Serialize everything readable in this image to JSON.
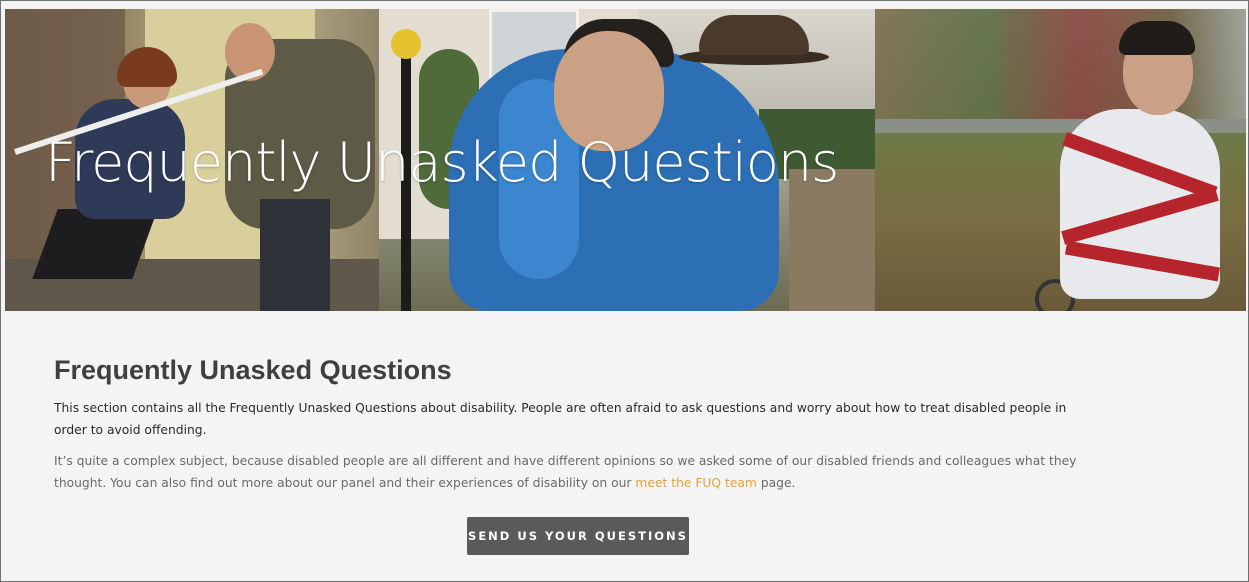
{
  "hero": {
    "title": "Frequently Unasked Questions"
  },
  "content": {
    "heading": "Frequently Unasked Questions",
    "intro": "This section contains all the Frequently Unasked Questions about disability. People are often afraid to ask questions and worry about how to treat disabled people in order to avoid offending.",
    "detail_before_link": "It’s quite a complex subject, because disabled people are all different and have different opinions so we asked some of our disabled friends and colleagues what they thought. You can also find out more about our panel and their experiences of disability on our ",
    "link_text": "meet the FUQ team",
    "detail_after_link": " page."
  },
  "cta": {
    "label": "SEND US YOUR QUESTIONS"
  },
  "colors": {
    "link": "#e5a03a",
    "button_bg": "#5a5a5a",
    "page_bg": "#f4f4f4"
  }
}
